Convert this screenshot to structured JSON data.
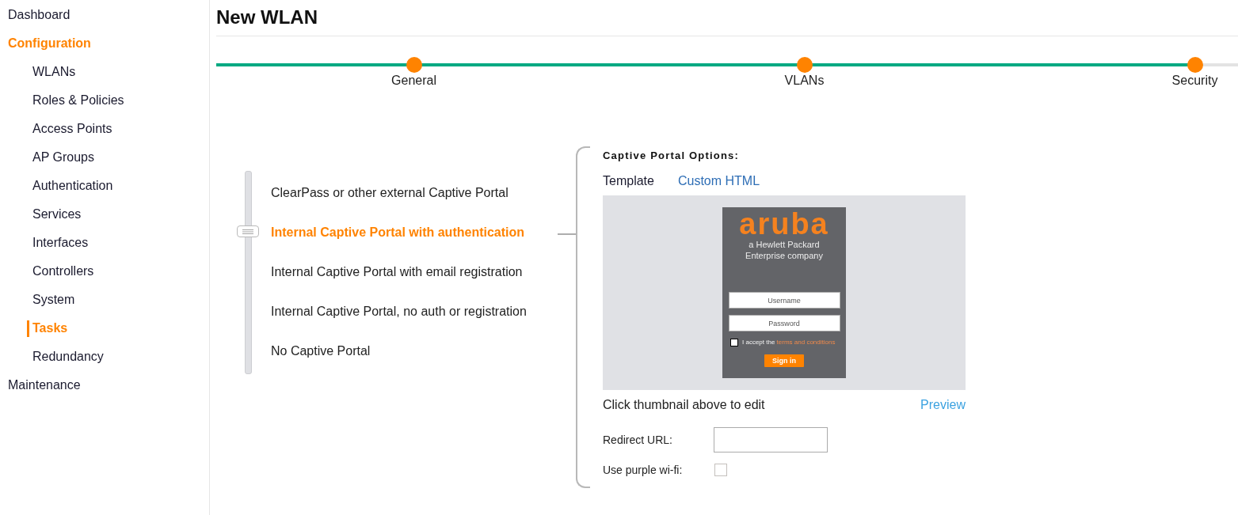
{
  "sidebar": {
    "items": [
      {
        "label": "Dashboard",
        "selected": false
      },
      {
        "label": "Configuration",
        "selected": true,
        "children": [
          {
            "label": "WLANs",
            "selected": false
          },
          {
            "label": "Roles & Policies",
            "selected": false
          },
          {
            "label": "Access Points",
            "selected": false
          },
          {
            "label": "AP Groups",
            "selected": false
          },
          {
            "label": "Authentication",
            "selected": false
          },
          {
            "label": "Services",
            "selected": false
          },
          {
            "label": "Interfaces",
            "selected": false
          },
          {
            "label": "Controllers",
            "selected": false
          },
          {
            "label": "System",
            "selected": false
          },
          {
            "label": "Tasks",
            "selected": true
          },
          {
            "label": "Redundancy",
            "selected": false
          }
        ]
      },
      {
        "label": "Maintenance",
        "selected": false
      }
    ]
  },
  "page": {
    "title": "New WLAN"
  },
  "stepper": {
    "level": 0.96,
    "steps": [
      {
        "label": "General"
      },
      {
        "label": "VLANs"
      },
      {
        "label": "Security"
      }
    ]
  },
  "portal_types": {
    "options": [
      {
        "label": "ClearPass or other external Captive Portal",
        "selected": false
      },
      {
        "label": "Internal Captive Portal with authentication",
        "selected": true
      },
      {
        "label": "Internal Captive Portal with email registration",
        "selected": false
      },
      {
        "label": "Internal Captive Portal, no auth or registration",
        "selected": false
      },
      {
        "label": "No Captive Portal",
        "selected": false
      }
    ]
  },
  "captive_portal_options": {
    "heading": "Captive Portal Options:",
    "tabs": [
      {
        "label": "Template",
        "selected": true
      },
      {
        "label": "Custom HTML",
        "selected": false
      }
    ],
    "thumbnail": {
      "logo": "aruba",
      "tagline": "a Hewlett Packard Enterprise company",
      "username_placeholder": "Username",
      "password_placeholder": "Password",
      "accept_text": "I accept the",
      "terms_link": "terms and conditions",
      "accept_checkbox": {
        "checked": false
      },
      "sign_in_button": "Sign in"
    },
    "hint": "Click thumbnail above to edit",
    "preview_link": "Preview",
    "fields": [
      {
        "kind": "url",
        "label": "Redirect URL:"
      },
      {
        "kind": "checkbox",
        "label": "Use purple wi-fi:",
        "checked": false
      }
    ]
  }
}
